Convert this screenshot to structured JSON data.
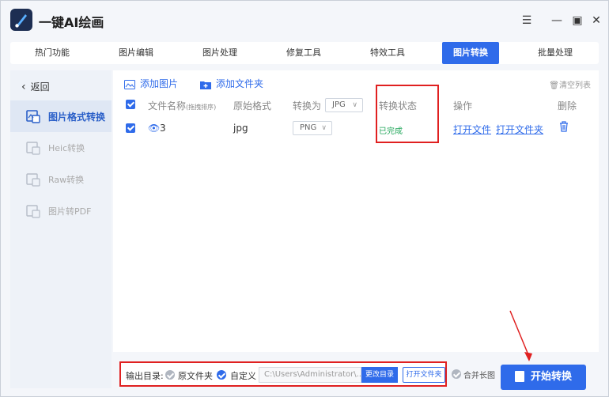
{
  "app": {
    "title": "一键AI绘画"
  },
  "window_controls": {
    "menu": "☰",
    "minimize": "—",
    "maximize": "▣",
    "close": "✕"
  },
  "tabs": [
    {
      "label": "热门功能",
      "active": false
    },
    {
      "label": "图片编辑",
      "active": false
    },
    {
      "label": "图片处理",
      "active": false
    },
    {
      "label": "修复工具",
      "active": false
    },
    {
      "label": "特效工具",
      "active": false
    },
    {
      "label": "图片转换",
      "active": true
    },
    {
      "label": "批量处理",
      "active": false
    }
  ],
  "sidebar": {
    "back_label": "返回",
    "items": [
      {
        "label": "图片格式转换",
        "active": true
      },
      {
        "label": "Heic转换",
        "active": false
      },
      {
        "label": "Raw转换",
        "active": false
      },
      {
        "label": "图片转PDF",
        "active": false
      }
    ]
  },
  "toolbar": {
    "add_image": "添加图片",
    "add_folder": "添加文件夹",
    "clear_list": "清空列表"
  },
  "table": {
    "headers": {
      "file_name": "文件名称",
      "file_name_hint": "(拖拽排序)",
      "original_format": "原始格式",
      "convert_to": "转换为",
      "convert_to_value": "JPG",
      "status": "转换状态",
      "actions": "操作",
      "delete": "删除"
    },
    "rows": [
      {
        "name": "3",
        "original_format": "jpg",
        "target_format": "PNG",
        "status": "已完成",
        "open_file": "打开文件",
        "open_folder": "打开文件夹"
      }
    ]
  },
  "output": {
    "label": "输出目录:",
    "option_original": "原文件夹",
    "option_custom": "自定义",
    "path": "C:\\Users\\Administrator\\...",
    "change_dir": "更改目录",
    "open_folder": "打开文件夹",
    "merge_long": "合并长图"
  },
  "start_button": "开始转换",
  "colors": {
    "accent": "#2f6bea",
    "success": "#21a65a",
    "annotation": "#e02020"
  }
}
